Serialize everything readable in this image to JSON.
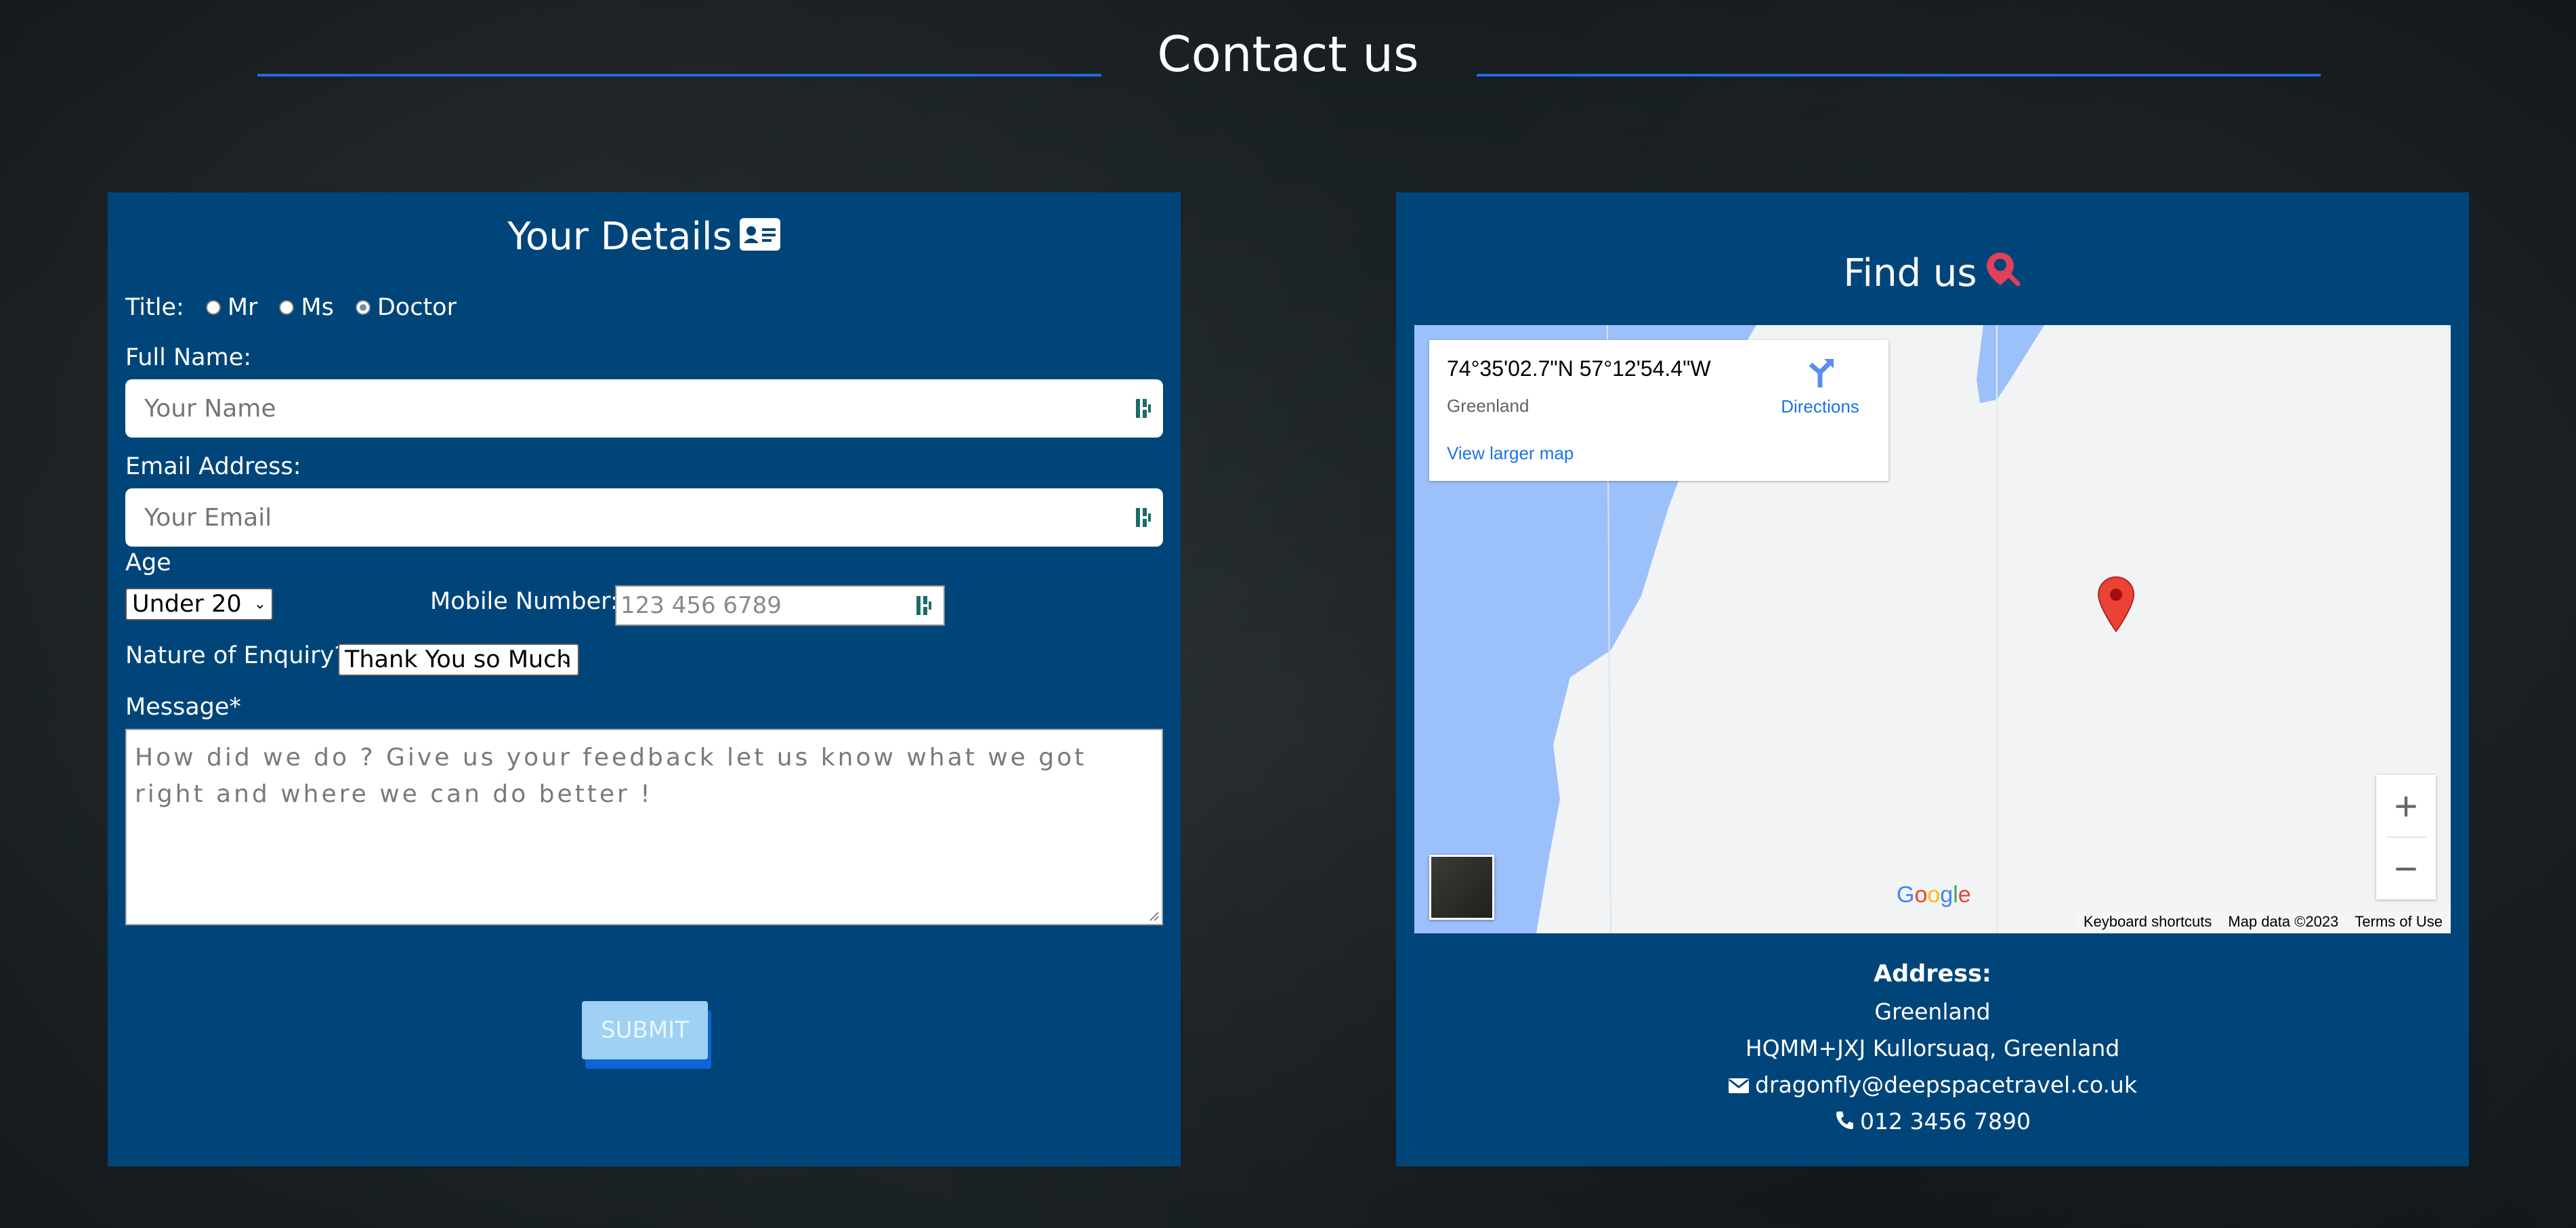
{
  "header": {
    "title": "Contact us"
  },
  "details": {
    "title": "Your Details",
    "title_label": "Title:",
    "title_options": [
      "Mr",
      "Ms",
      "Doctor"
    ],
    "full_name_label": "Full Name:",
    "full_name_placeholder": "Your Name",
    "email_label": "Email Address:",
    "email_placeholder": "Your Email",
    "age_label": "Age",
    "age_value": "Under 20",
    "mobile_label": "Mobile Number:",
    "mobile_placeholder": "123 456 6789",
    "enquiry_label": "Nature of Enquiry?",
    "enquiry_value": "Thank You so Much",
    "message_label": "Message*",
    "message_placeholder": "How did we do ? Give us your feedback let us know what we got right and where we can do better !",
    "submit_label": "SUBMIT"
  },
  "find": {
    "title": "Find us",
    "map": {
      "coords": "74°35'02.7\"N 57°12'54.4\"W",
      "place": "Greenland",
      "directions": "Directions",
      "larger_map": "View larger map",
      "zoom_in": "+",
      "zoom_out": "−",
      "google": "Google",
      "footer": [
        "Keyboard shortcuts",
        "Map data ©2023",
        "Terms of Use"
      ]
    },
    "address_title": "Address:",
    "address_line1": "Greenland",
    "address_line2": "HQMM+JXJ Kullorsuaq, Greenland",
    "email": "dragonfly@deepspacetravel.co.uk",
    "phone": "012 3456 7890"
  },
  "colors": {
    "panel": "#00457a",
    "accent_line": "#1f6ce0",
    "submit": "#9ed1f4",
    "pin": "#ea4335"
  }
}
